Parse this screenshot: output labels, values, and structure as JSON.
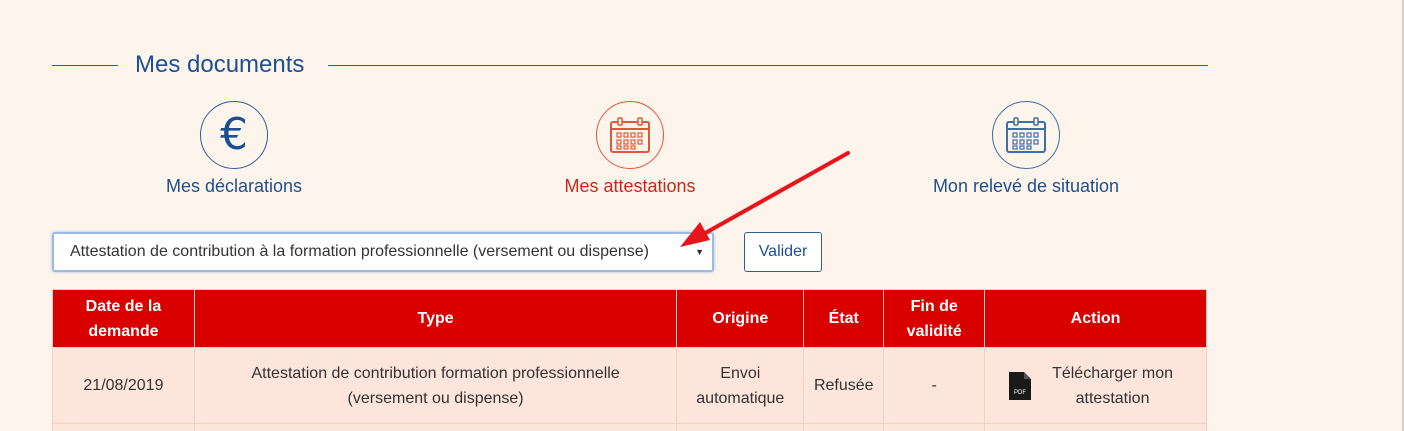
{
  "section": {
    "title": "Mes documents"
  },
  "tiles": [
    {
      "label": "Mes déclarations",
      "icon": "euro-icon"
    },
    {
      "label": "Mes attestations",
      "icon": "calendar-icon"
    },
    {
      "label": "Mon relevé de situation",
      "icon": "calendar-icon"
    }
  ],
  "colors": {
    "primary_blue": "#1e4f8f",
    "accent_red": "#d90000",
    "active_tile": "#c8281c",
    "background": "#fdf4ec"
  },
  "filter": {
    "selected": "Attestation de contribution à la formation professionnelle (versement ou dispense)",
    "submit_label": "Valider"
  },
  "table": {
    "headers": [
      "Date de la demande",
      "Type",
      "Origine",
      "État",
      "Fin de validité",
      "Action"
    ],
    "rows": [
      {
        "date": "21/08/2019",
        "type": "Attestation de contribution formation professionnelle (versement ou dispense)",
        "origine": "Envoi automatique",
        "etat": "Refusée",
        "fin": "-",
        "action": "Télécharger mon attestation",
        "action_icon": "pdf-icon",
        "pdf_text": "PDF"
      }
    ]
  }
}
